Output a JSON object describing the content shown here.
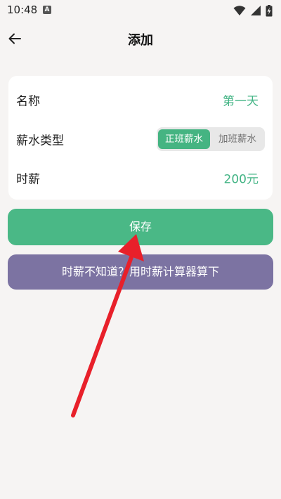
{
  "status_bar": {
    "time": "10:48",
    "notification_badge": "A"
  },
  "app_bar": {
    "title": "添加",
    "back_icon": "arrow-left-icon"
  },
  "form": {
    "name": {
      "label": "名称",
      "value": "第一天"
    },
    "salary_type": {
      "label": "薪水类型",
      "options": [
        "正班薪水",
        "加班薪水"
      ],
      "selected": "正班薪水"
    },
    "hourly_wage": {
      "label": "时薪",
      "value": "200元"
    }
  },
  "actions": {
    "save_label": "保存",
    "calculator_label": "时薪不知道？用时薪计算器算下"
  },
  "colors": {
    "accent_green": "#45b482",
    "purple_button": "#7c73a2",
    "annotation_arrow": "#e8202a",
    "background": "#f6f4f3"
  }
}
